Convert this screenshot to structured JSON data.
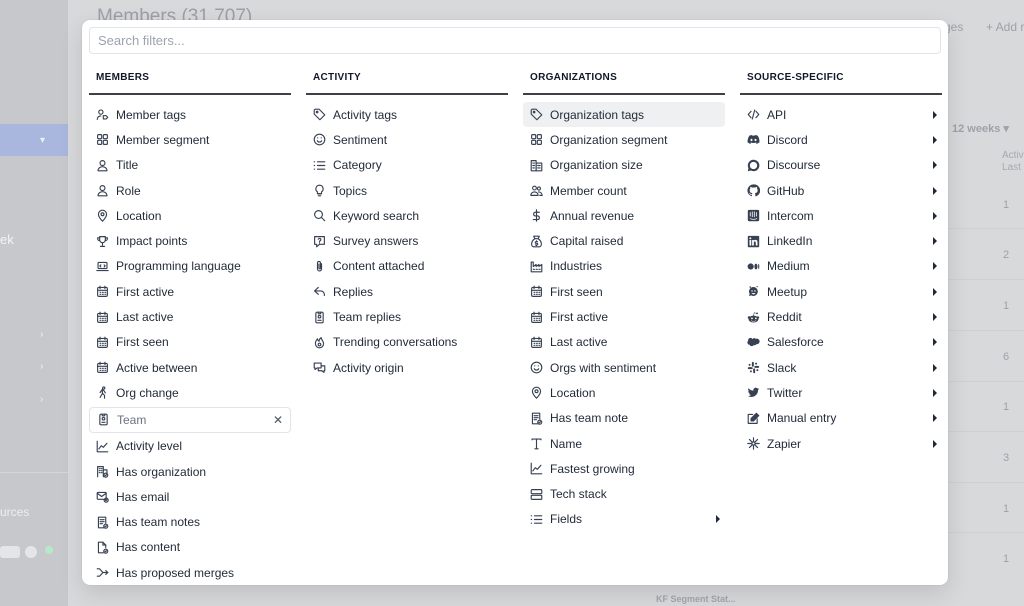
{
  "background": {
    "page_title": "Members (31,707)",
    "add_button": "+ Add r",
    "merges_button": "ges",
    "time_filter": "12 weeks",
    "column_header": "Activ",
    "column_sub": "Last",
    "row_values": [
      "1",
      "2",
      "1",
      "6",
      "1",
      "3",
      "1",
      "1"
    ],
    "sidebar_fragment": "ek",
    "sources_fragment": "urces",
    "footer_fragment": "KF Segment Stat..."
  },
  "search": {
    "placeholder": "Search filters..."
  },
  "columns": [
    {
      "heading": "Members",
      "items": [
        {
          "label": "Member tags",
          "icon": "member-tags-icon"
        },
        {
          "label": "Member segment",
          "icon": "segment-icon"
        },
        {
          "label": "Title",
          "icon": "person-icon"
        },
        {
          "label": "Role",
          "icon": "person-icon"
        },
        {
          "label": "Location",
          "icon": "location-pin-icon"
        },
        {
          "label": "Impact points",
          "icon": "trophy-icon"
        },
        {
          "label": "Programming language",
          "icon": "laptop-icon"
        },
        {
          "label": "First active",
          "icon": "calendar-icon"
        },
        {
          "label": "Last active",
          "icon": "calendar-icon"
        },
        {
          "label": "First seen",
          "icon": "calendar-icon"
        },
        {
          "label": "Active between",
          "icon": "calendar-icon"
        },
        {
          "label": "Org change",
          "icon": "walking-icon"
        },
        {
          "label": "Team",
          "icon": "badge-icon",
          "selected": true
        },
        {
          "label": "Activity level",
          "icon": "chart-line-icon"
        },
        {
          "label": "Has organization",
          "icon": "building-check-icon"
        },
        {
          "label": "Has email",
          "icon": "envelope-check-icon"
        },
        {
          "label": "Has team notes",
          "icon": "note-check-icon"
        },
        {
          "label": "Has content",
          "icon": "file-check-icon"
        },
        {
          "label": "Has proposed merges",
          "icon": "merge-icon"
        }
      ]
    },
    {
      "heading": "Activity",
      "items": [
        {
          "label": "Activity tags",
          "icon": "tag-icon"
        },
        {
          "label": "Sentiment",
          "icon": "smile-icon"
        },
        {
          "label": "Category",
          "icon": "list-icon"
        },
        {
          "label": "Topics",
          "icon": "lightbulb-icon"
        },
        {
          "label": "Keyword search",
          "icon": "search-icon"
        },
        {
          "label": "Survey answers",
          "icon": "question-icon"
        },
        {
          "label": "Content attached",
          "icon": "paperclip-icon"
        },
        {
          "label": "Replies",
          "icon": "reply-icon"
        },
        {
          "label": "Team replies",
          "icon": "badge-icon"
        },
        {
          "label": "Trending conversations",
          "icon": "fire-icon"
        },
        {
          "label": "Activity origin",
          "icon": "chat-icon"
        }
      ]
    },
    {
      "heading": "Organizations",
      "items": [
        {
          "label": "Organization tags",
          "icon": "tag-icon",
          "highlight": true
        },
        {
          "label": "Organization segment",
          "icon": "segment-icon"
        },
        {
          "label": "Organization size",
          "icon": "buildings-icon"
        },
        {
          "label": "Member count",
          "icon": "people-icon"
        },
        {
          "label": "Annual revenue",
          "icon": "dollar-icon"
        },
        {
          "label": "Capital raised",
          "icon": "money-bag-icon"
        },
        {
          "label": "Industries",
          "icon": "factory-icon"
        },
        {
          "label": "First seen",
          "icon": "calendar-icon"
        },
        {
          "label": "First active",
          "icon": "calendar-icon"
        },
        {
          "label": "Last active",
          "icon": "calendar-icon"
        },
        {
          "label": "Orgs with sentiment",
          "icon": "smile-icon"
        },
        {
          "label": "Location",
          "icon": "location-pin-icon"
        },
        {
          "label": "Has team note",
          "icon": "note-check-icon"
        },
        {
          "label": "Name",
          "icon": "text-icon"
        },
        {
          "label": "Fastest growing",
          "icon": "chart-line-icon"
        },
        {
          "label": "Tech stack",
          "icon": "server-icon"
        },
        {
          "label": "Fields",
          "icon": "list-icon",
          "submenu": true
        }
      ]
    },
    {
      "heading": "Source-specific",
      "items": [
        {
          "label": "API",
          "icon": "code-icon",
          "submenu": true
        },
        {
          "label": "Discord",
          "icon": "discord-icon",
          "submenu": true
        },
        {
          "label": "Discourse",
          "icon": "discourse-icon",
          "submenu": true
        },
        {
          "label": "GitHub",
          "icon": "github-icon",
          "submenu": true
        },
        {
          "label": "Intercom",
          "icon": "intercom-icon",
          "submenu": true
        },
        {
          "label": "LinkedIn",
          "icon": "linkedin-icon",
          "submenu": true
        },
        {
          "label": "Medium",
          "icon": "medium-icon",
          "submenu": true
        },
        {
          "label": "Meetup",
          "icon": "meetup-icon",
          "submenu": true
        },
        {
          "label": "Reddit",
          "icon": "reddit-icon",
          "submenu": true
        },
        {
          "label": "Salesforce",
          "icon": "salesforce-icon",
          "submenu": true
        },
        {
          "label": "Slack",
          "icon": "slack-icon",
          "submenu": true
        },
        {
          "label": "Twitter",
          "icon": "twitter-icon",
          "submenu": true
        },
        {
          "label": "Manual entry",
          "icon": "edit-icon",
          "submenu": true
        },
        {
          "label": "Zapier",
          "icon": "zapier-icon",
          "submenu": true
        }
      ]
    }
  ]
}
